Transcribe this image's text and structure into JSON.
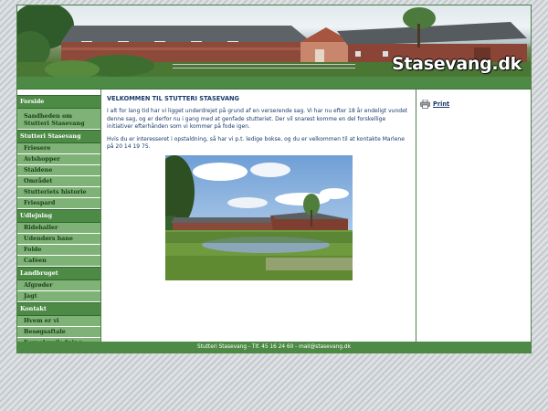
{
  "header": {
    "brand": "Stasevang.dk"
  },
  "sidebar": {
    "sections": [
      {
        "title": "Forside",
        "items": [
          "Sandheden om Stutteri Stasevang"
        ]
      },
      {
        "title": "Stutteri Stasevang",
        "items": [
          "Friesere",
          "Avlshopper",
          "Staldene",
          "Området",
          "Stutteriets historie",
          "Friespard"
        ]
      },
      {
        "title": "Udlejning",
        "items": [
          "Ridehaller",
          "Udendørs bane",
          "Folde",
          "Caféen"
        ]
      },
      {
        "title": "Landbruget",
        "items": [
          "Afgrøder",
          "Jagt"
        ]
      },
      {
        "title": "Kontakt",
        "items": [
          "Hvem er vi",
          "Besøgsaftale",
          "Kørselsvejledning"
        ]
      }
    ]
  },
  "main": {
    "heading": "VELKOMMEN TIL STUTTERI STASEVANG",
    "paragraph1": "I alt for lang tid har vi ligget underdrejet på grund af en verserende sag. Vi har nu efter 18 år endeligt vundet denne sag, og er derfor nu i gang med at genfade stutteriet. Der vil snarest komme en del forskellige initiativer efterhånden som vi kommer på fode igen.",
    "paragraph2": "Hvis du er interesseret i opstaldning, så har vi p.t. ledige bokse, og du er velkommen til at kontakte Marlene på 20 14 19 75."
  },
  "right": {
    "print_label": "Print",
    "print_icon": "printer-icon"
  },
  "footer": {
    "text": "Stutteri Stasevang - Tlf. 45 16 24 60 - mail@stasevang.dk"
  },
  "colors": {
    "green": "#4d8a45",
    "nav_bg": "#7fb277",
    "text_blue": "#1a3a6b"
  }
}
